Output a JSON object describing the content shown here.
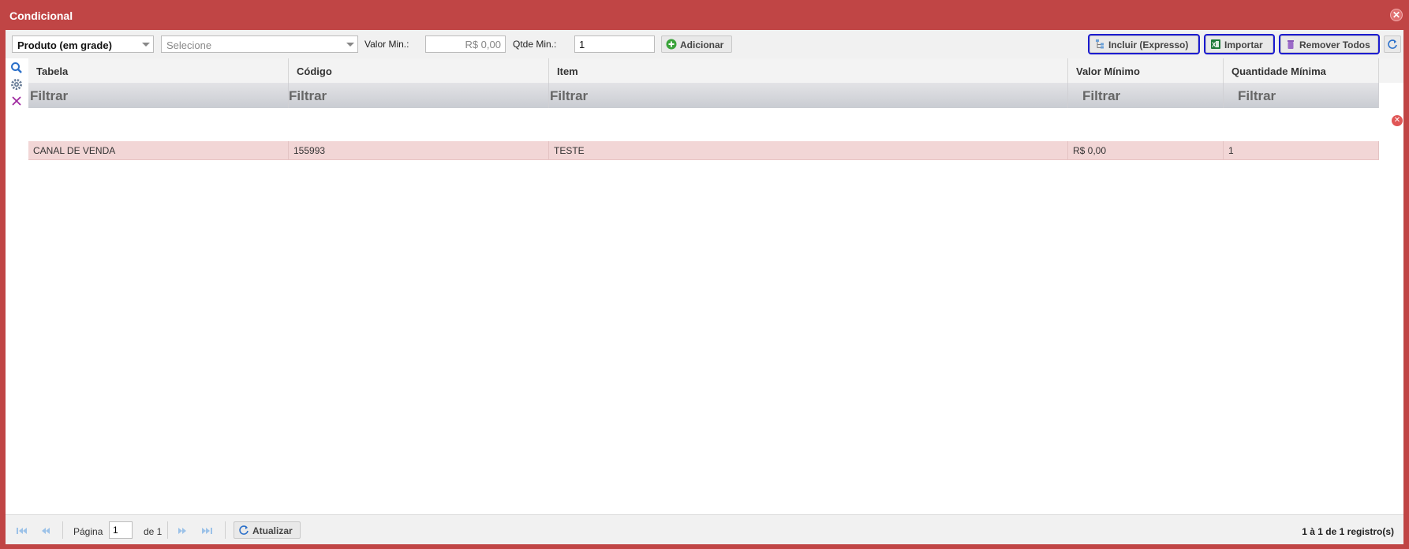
{
  "window": {
    "title": "Condicional"
  },
  "toolbar": {
    "type_select": "Produto (em grade)",
    "item_select_placeholder": "Selecione",
    "valor_min_label": "Valor Min.:",
    "valor_min_value": "R$ 0,00",
    "qtde_min_label": "Qtde Min.:",
    "qtde_min_value": "1",
    "add_label": "Adicionar",
    "incluir_label": "Incluir (Expresso)",
    "importar_label": "Importar",
    "remover_label": "Remover Todos"
  },
  "grid": {
    "columns": [
      "Tabela",
      "Código",
      "Item",
      "Valor Mínimo",
      "Quantidade Mínima"
    ],
    "filter_label": "Filtrar",
    "rows": [
      [
        "CANAL DE VENDA",
        "155993",
        "TESTE",
        "R$ 0,00",
        "1"
      ]
    ]
  },
  "pager": {
    "page_label": "Página",
    "page_value": "1",
    "of_label": "de 1",
    "refresh_label": "Atualizar",
    "info": "1 à 1 de 1 registro(s)"
  },
  "colors": {
    "title_bar": "#c04545",
    "row_highlight": "#f2d6d6",
    "focus_outline": "#1b1bd0"
  }
}
